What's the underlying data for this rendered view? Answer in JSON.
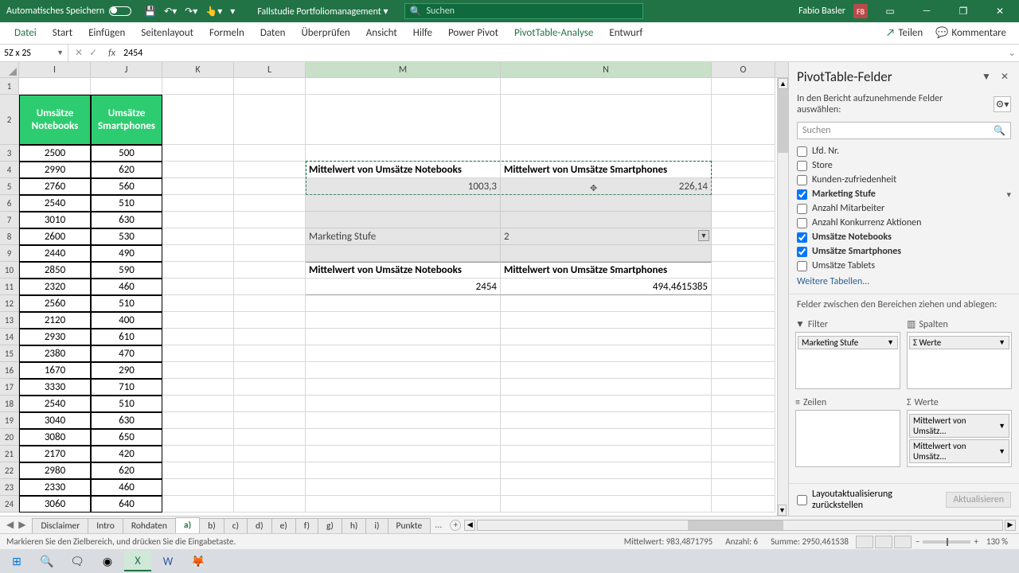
{
  "titlebar": {
    "autosave": "Automatisches Speichern",
    "doc": "Fallstudie Portfoliomanagement",
    "search_placeholder": "Suchen",
    "user": "Fabio Basler",
    "user_initials": "FB"
  },
  "ribbon": {
    "tabs": [
      "Datei",
      "Start",
      "Einfügen",
      "Seitenlayout",
      "Formeln",
      "Daten",
      "Überprüfen",
      "Ansicht",
      "Hilfe",
      "Power Pivot",
      "PivotTable-Analyse",
      "Entwurf"
    ],
    "share": "Teilen",
    "comments": "Kommentare"
  },
  "formula": {
    "namebox": "5Z x 2S",
    "value": "2454",
    "fx": "fx"
  },
  "cols": [
    "I",
    "J",
    "K",
    "L",
    "M",
    "N",
    "O"
  ],
  "headers": {
    "I": "Umsätze Notebooks",
    "J": "Umsätze Smartphones"
  },
  "data": {
    "I": [
      2500,
      2990,
      2760,
      2540,
      3010,
      2600,
      2440,
      2850,
      2320,
      2560,
      2120,
      2930,
      2380,
      1670,
      3330,
      2540,
      3040,
      3080,
      2170,
      2980,
      2330,
      3060
    ],
    "J": [
      500,
      620,
      560,
      510,
      630,
      530,
      490,
      590,
      460,
      510,
      400,
      610,
      470,
      290,
      710,
      510,
      630,
      650,
      420,
      620,
      460,
      640
    ]
  },
  "pivot1": {
    "h1": "Mittelwert von Umsätze Notebooks",
    "h2": "Mittelwert von Umsätze Smartphones",
    "v1": "1003,3",
    "v2": "226,14"
  },
  "pivot2": {
    "filter_label": "Marketing Stufe",
    "filter_value": "2",
    "h1": "Mittelwert von Umsätze Notebooks",
    "h2": "Mittelwert von Umsätze Smartphones",
    "v1": "2454",
    "v2": "494,4615385"
  },
  "fields": {
    "title": "PivotTable-Felder",
    "instr": "In den Bericht aufzunehmende Felder auswählen:",
    "search": "Suchen",
    "list": [
      {
        "label": "Lfd. Nr.",
        "checked": false
      },
      {
        "label": "Store",
        "checked": false
      },
      {
        "label": "Kunden-zufriedenheit",
        "checked": false
      },
      {
        "label": "Marketing Stufe",
        "checked": true,
        "funnel": true
      },
      {
        "label": "Anzahl Mitarbeiter",
        "checked": false
      },
      {
        "label": "Anzahl Konkurrenz Aktionen",
        "checked": false
      },
      {
        "label": "Umsätze Notebooks",
        "checked": true
      },
      {
        "label": "Umsätze Smartphones",
        "checked": true
      },
      {
        "label": "Umsätze Tablets",
        "checked": false
      }
    ],
    "more": "Weitere Tabellen...",
    "dragtxt": "Felder zwischen den Bereichen ziehen und ablegen:",
    "q_filter": "Filter",
    "q_cols": "Spalten",
    "q_rows": "Zeilen",
    "q_vals": "Werte",
    "pill_filter": "Marketing Stufe",
    "pill_cols": "Σ Werte",
    "pill_val1": "Mittelwert von Umsätz...",
    "pill_val2": "Mittelwert von Umsätz...",
    "defer": "Layoutaktualisierung zurückstellen",
    "update": "Aktualisieren"
  },
  "sheets": {
    "tabs": [
      "Disclaimer",
      "Intro",
      "Rohdaten",
      "a)",
      "b)",
      "c)",
      "d)",
      "e)",
      "f)",
      "g)",
      "h)",
      "i)",
      "Punkte"
    ],
    "active": "a)",
    "more": "..."
  },
  "status": {
    "msg": "Markieren Sie den Zielbereich, und drücken Sie die Eingabetaste.",
    "avg_l": "Mittelwert:",
    "avg_v": "983,4871795",
    "cnt_l": "Anzahl:",
    "cnt_v": "6",
    "sum_l": "Summe:",
    "sum_v": "2950,461538",
    "zoom": "130 %"
  }
}
